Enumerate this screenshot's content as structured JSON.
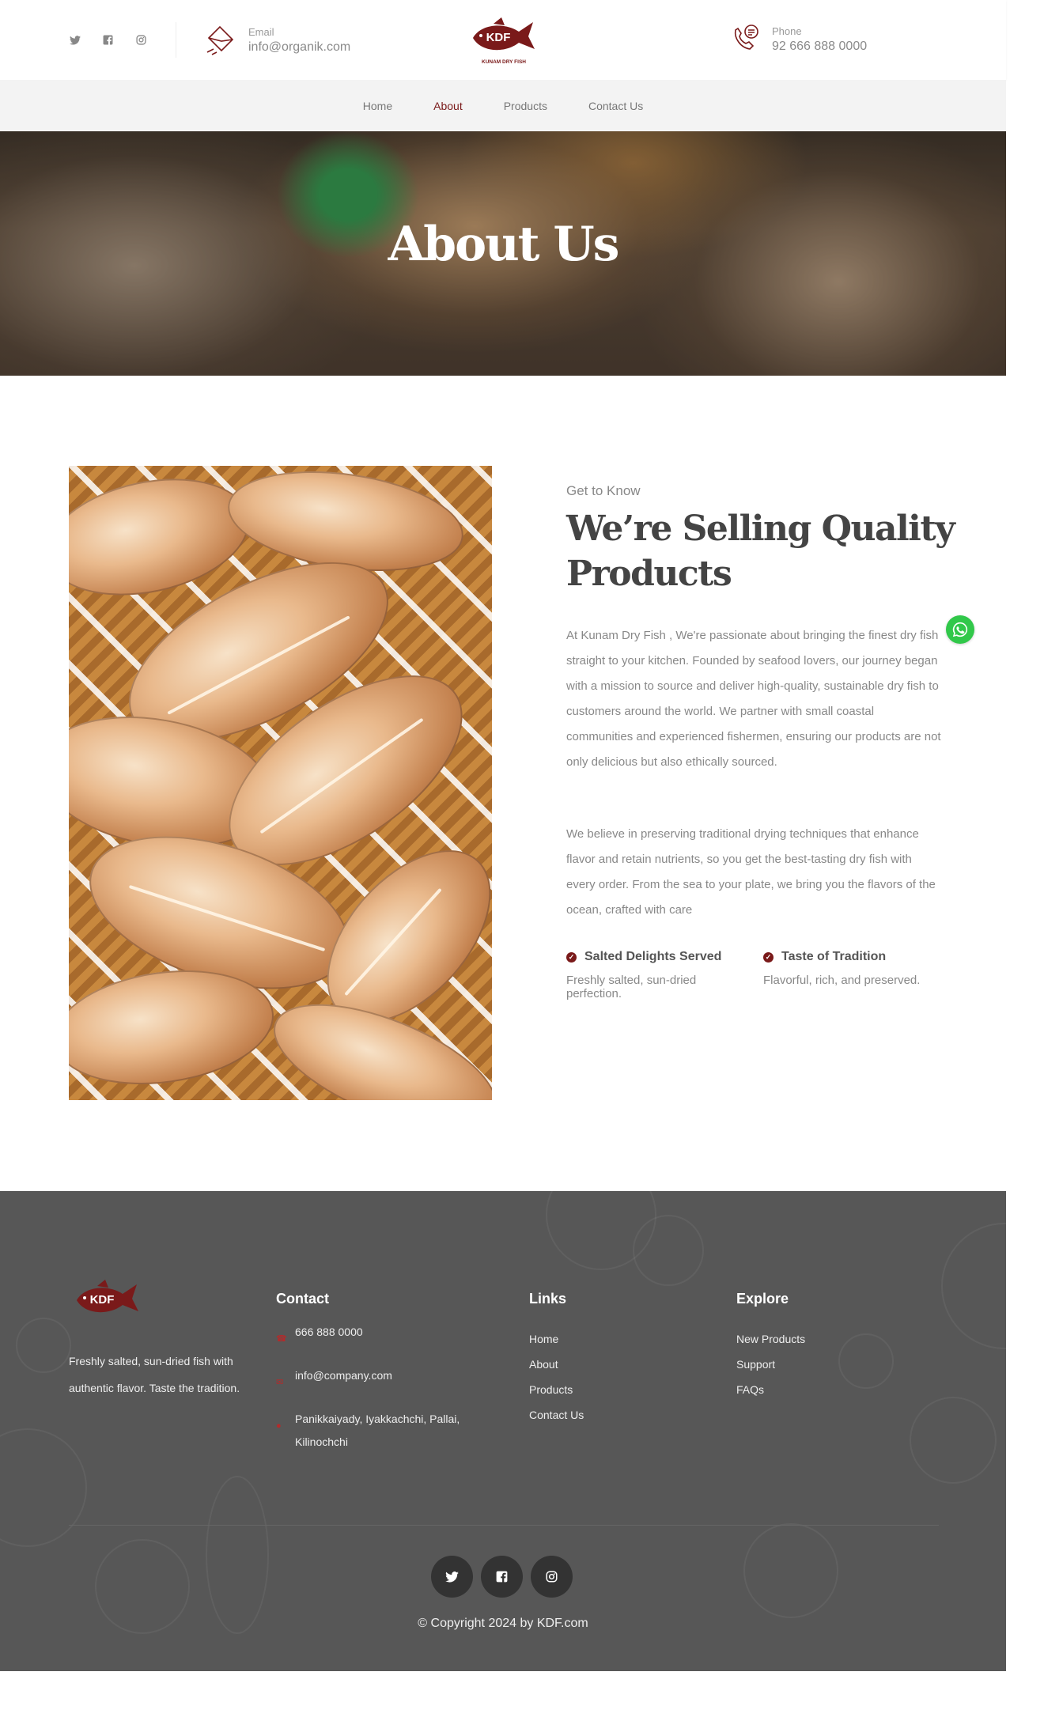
{
  "header": {
    "email_label": "Email",
    "email_value": "info@organik.com",
    "phone_label": "Phone",
    "phone_value": "92 666 888 0000",
    "logo_text": "KDF",
    "logo_sub": "KUNAM DRY FISH",
    "socials": [
      "twitter-icon",
      "facebook-icon",
      "instagram-icon"
    ]
  },
  "nav": {
    "items": [
      {
        "label": "Home"
      },
      {
        "label": "About"
      },
      {
        "label": "Products"
      },
      {
        "label": "Contact Us"
      }
    ],
    "active": "About"
  },
  "hero": {
    "title": "About Us"
  },
  "about": {
    "eyebrow": "Get to Know",
    "heading": "We’re Selling Quality Products",
    "para1": "At Kunam Dry Fish , We're passionate about bringing the finest dry fish straight to your kitchen. Founded by seafood lovers, our journey began with a mission to source and deliver high-quality, sustainable dry fish to customers around the world. We partner with small coastal communities and experienced fishermen, ensuring our products are not only delicious but also ethically sourced.",
    "para2": "We believe in preserving traditional drying techniques that enhance flavor and retain nutrients, so you get the best-tasting dry fish with every order. From the sea to your plate, we bring you the flavors of the ocean, crafted with care",
    "features": [
      {
        "title": "Salted Delights Served",
        "desc": "Freshly salted, sun-dried perfection."
      },
      {
        "title": "Taste of Tradition",
        "desc": "Flavorful, rich, and preserved."
      }
    ]
  },
  "footer": {
    "logo_text": "KDF",
    "about": "Freshly salted, sun-dried fish with authentic flavor. Taste the tradition.",
    "contact_heading": "Contact",
    "phone": "666 888 0000",
    "email": "info@company.com",
    "address": "Panikkaiyady, Iyakkachchi, Pallai, Kilinochchi",
    "links_heading": "Links",
    "links": [
      "Home",
      "About",
      "Products",
      "Contact Us"
    ],
    "explore_heading": "Explore",
    "explore": [
      "New Products",
      "Support",
      "FAQs"
    ],
    "copyright": "© Copyright 2024 by KDF.com"
  },
  "colors": {
    "accent": "#7a1a1a",
    "footer_bg": "#575757",
    "nav_bg": "#f3f3f3",
    "whatsapp": "#31c84a"
  }
}
